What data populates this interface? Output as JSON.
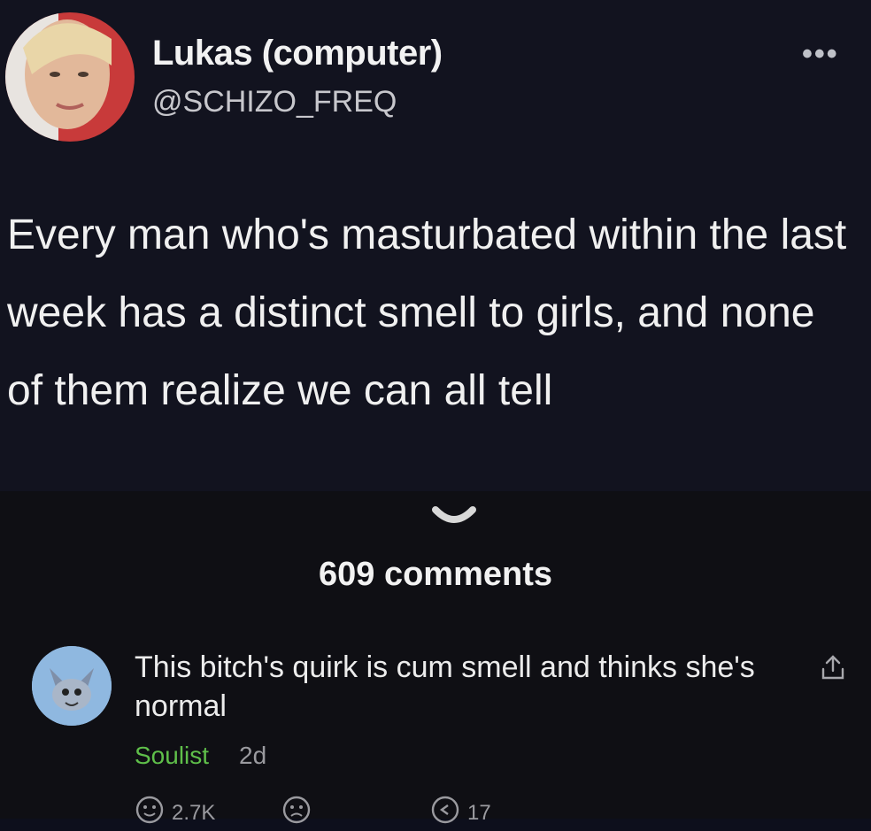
{
  "tweet": {
    "display_name": "Lukas (computer)",
    "handle": "@SCHIZO_FREQ",
    "more_label": "•••",
    "text": "Every man who's masturbated within the last week has a distinct smell to girls, and none of them realize we can all tell"
  },
  "comments": {
    "count_label": "609 comments"
  },
  "comment": {
    "text": "This bitch's quirk is cum smell and thinks she's normal",
    "author": "Soulist",
    "age": "2d",
    "like_count": "2.7K",
    "reply_count": "17"
  },
  "colors": {
    "author_green": "#5fbf4a",
    "tweet_bg": "#12131f",
    "comments_bg": "#0f0f14"
  },
  "icons": [
    "more-icon",
    "chevron-down-icon",
    "share-icon",
    "smile-icon",
    "frown-icon",
    "reply-icon"
  ]
}
